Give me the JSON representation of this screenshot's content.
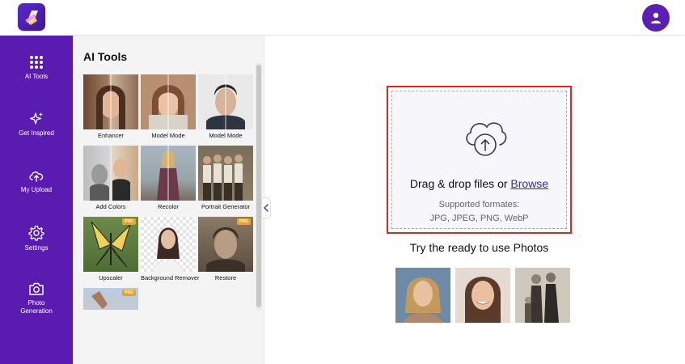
{
  "topbar": {
    "logo_icon": "app-logo-icon",
    "avatar_icon": "user-avatar-icon"
  },
  "sidebar": {
    "items": [
      {
        "label": "AI Tools",
        "icon": "grid-icon"
      },
      {
        "label": "Get Inspired",
        "icon": "sparkles-icon"
      },
      {
        "label": "My Upload",
        "icon": "cloud-upload-icon"
      },
      {
        "label": "Settings",
        "icon": "gear-icon"
      },
      {
        "label": "Photo Generation",
        "icon": "camera-icon"
      }
    ]
  },
  "tools_panel": {
    "title": "AI Tools",
    "tools": [
      {
        "label": "Enhancer",
        "pro": false
      },
      {
        "label": "Model Mode",
        "pro": false
      },
      {
        "label": "Model Mode",
        "pro": false
      },
      {
        "label": "Add Colors",
        "pro": false
      },
      {
        "label": "Recolor",
        "pro": false
      },
      {
        "label": "Portrait Generator",
        "pro": false
      },
      {
        "label": "Upscaler",
        "pro": true
      },
      {
        "label": "Background Remover",
        "pro": false
      },
      {
        "label": "Restore",
        "pro": true
      },
      {
        "label": "",
        "pro": true
      }
    ],
    "pro_badge": "PRO"
  },
  "upload": {
    "drag_text": "Drag & drop files or",
    "browse_label": "Browse",
    "formats_line1": "Supported formates:",
    "formats_line2": "JPG, JPEG, PNG, WebP"
  },
  "samples": {
    "title": "Try the ready to use Photos"
  },
  "colors": {
    "brand_purple": "#5a1cb0",
    "highlight_red": "#d9272e",
    "pro_orange": "#f2a319"
  }
}
